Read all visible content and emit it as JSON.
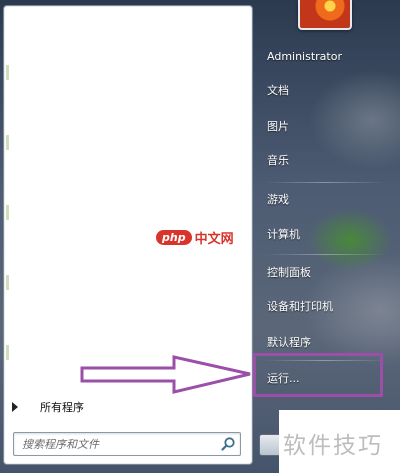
{
  "start_menu": {
    "all_programs_label": "所有程序",
    "search_placeholder": "搜索程序和文件",
    "search_value": "",
    "user_name": "Administrator",
    "right_items": [
      {
        "label": "文档"
      },
      {
        "label": "图片"
      },
      {
        "label": "音乐"
      },
      {
        "label": "游戏"
      },
      {
        "label": "计算机"
      },
      {
        "label": "控制面板"
      },
      {
        "label": "设备和打印机"
      },
      {
        "label": "默认程序"
      },
      {
        "label": "运行..."
      }
    ]
  },
  "watermarks": {
    "php_badge": "php",
    "php_site": "中文网",
    "corner_text": "软件技巧"
  },
  "colors": {
    "highlight_purple": "#9b4fa8",
    "php_red": "#d9342b"
  },
  "icons": {
    "search": "magnifier-icon",
    "all_programs_arrow": "triangle-right-icon",
    "shutdown": "shutdown-button"
  }
}
